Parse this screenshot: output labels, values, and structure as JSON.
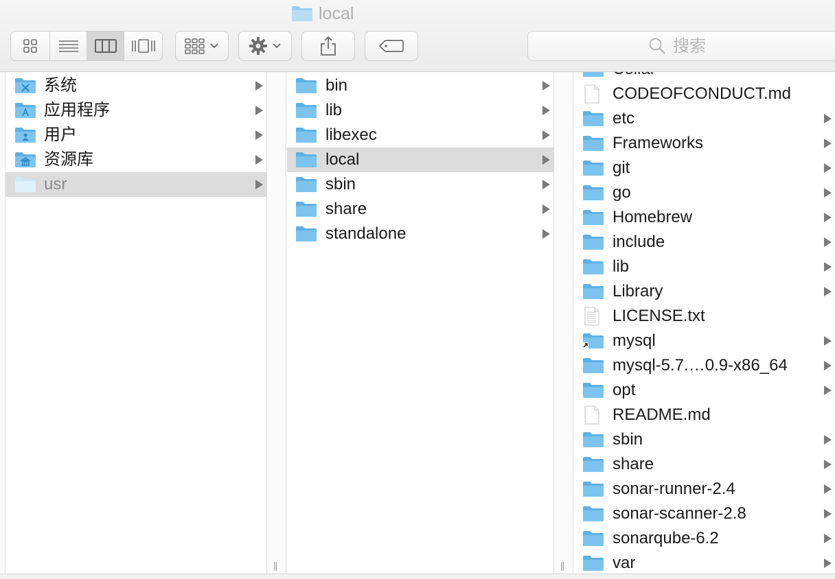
{
  "window": {
    "title": "local"
  },
  "toolbar": {
    "view_buttons": [
      {
        "name": "icon-view-button",
        "icon": "grid-icon"
      },
      {
        "name": "list-view-button",
        "icon": "list-icon"
      },
      {
        "name": "column-view-button",
        "icon": "columns-icon",
        "active": true
      },
      {
        "name": "cover-flow-view-button",
        "icon": "cover-flow-icon"
      }
    ],
    "arrange_icon": "arrange-icon",
    "action_icon": "gear-icon",
    "share_icon": "share-icon",
    "tag_icon": "tag-icon"
  },
  "search": {
    "placeholder": "搜索",
    "icon": "search-icon"
  },
  "column1": {
    "items": [
      {
        "label": "系统",
        "icon": "system-folder-icon"
      },
      {
        "label": "应用程序",
        "icon": "applications-folder-icon"
      },
      {
        "label": "用户",
        "icon": "users-folder-icon"
      },
      {
        "label": "资源库",
        "icon": "library-folder-icon"
      },
      {
        "label": "usr",
        "icon": "folder-icon",
        "selected": true,
        "dim": true
      }
    ]
  },
  "column2": {
    "items": [
      {
        "label": "bin"
      },
      {
        "label": "lib"
      },
      {
        "label": "libexec"
      },
      {
        "label": "local",
        "selected": true
      },
      {
        "label": "sbin"
      },
      {
        "label": "share"
      },
      {
        "label": "standalone"
      }
    ]
  },
  "column3": {
    "items": [
      {
        "label": "Cellar",
        "kind": "folder",
        "partial": true
      },
      {
        "label": "CODEOFCONDUCT.md",
        "kind": "file"
      },
      {
        "label": "etc",
        "kind": "folder"
      },
      {
        "label": "Frameworks",
        "kind": "folder"
      },
      {
        "label": "git",
        "kind": "folder"
      },
      {
        "label": "go",
        "kind": "folder"
      },
      {
        "label": "Homebrew",
        "kind": "folder"
      },
      {
        "label": "include",
        "kind": "folder"
      },
      {
        "label": "lib",
        "kind": "folder"
      },
      {
        "label": "Library",
        "kind": "folder"
      },
      {
        "label": "LICENSE.txt",
        "kind": "textfile"
      },
      {
        "label": "mysql",
        "kind": "alias"
      },
      {
        "label": "mysql-5.7.…0.9-x86_64",
        "kind": "folder"
      },
      {
        "label": "opt",
        "kind": "folder"
      },
      {
        "label": "README.md",
        "kind": "file"
      },
      {
        "label": "sbin",
        "kind": "folder"
      },
      {
        "label": "share",
        "kind": "folder"
      },
      {
        "label": "sonar-runner-2.4",
        "kind": "folder"
      },
      {
        "label": "sonar-scanner-2.8",
        "kind": "folder"
      },
      {
        "label": "sonarqube-6.2",
        "kind": "folder"
      },
      {
        "label": "var",
        "kind": "folder"
      }
    ]
  },
  "colors": {
    "folder_front": "#7cc4ef",
    "folder_back": "#5fb0e3",
    "selection": "#dcdcdc",
    "arrow": "#7a7a7a"
  }
}
